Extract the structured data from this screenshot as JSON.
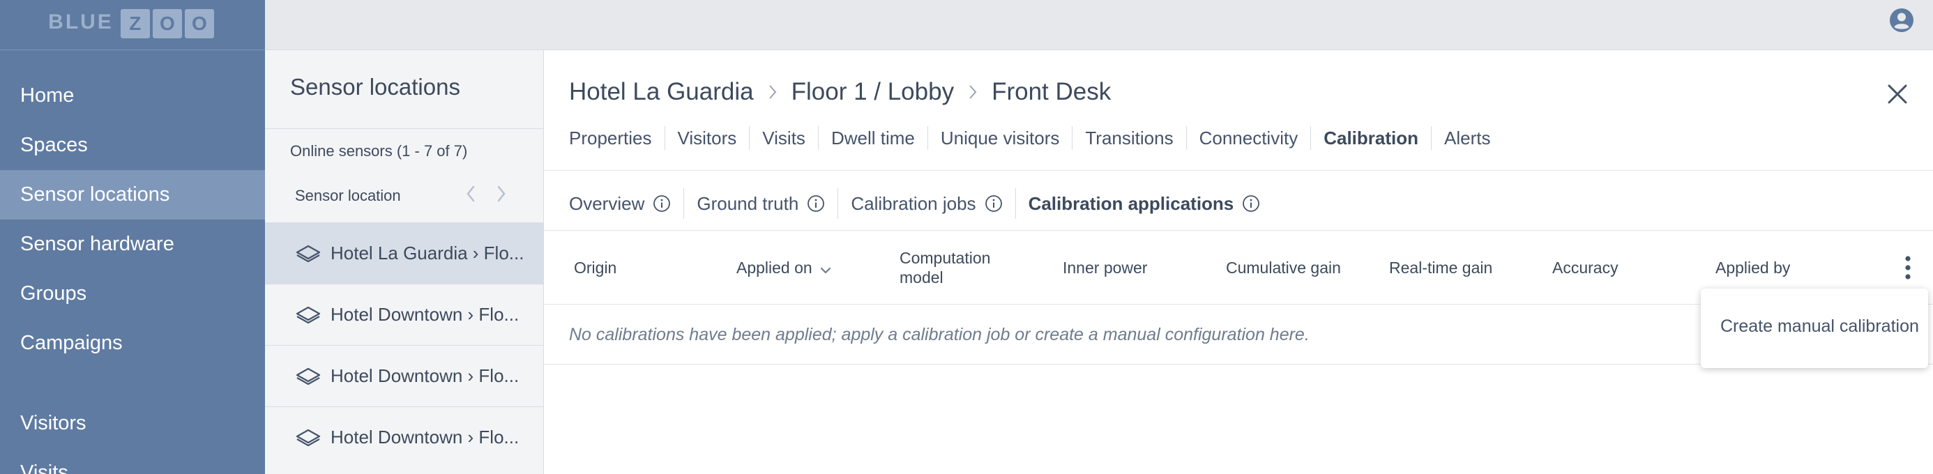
{
  "brand": {
    "word": "BLUE",
    "boxed_letters": [
      "Z",
      "O",
      "O"
    ]
  },
  "colors": {
    "nav_bg": "#5f7ba2",
    "nav_active": "#7f97b9",
    "topbar_bg": "#e6e8eb",
    "list_bg": "#f3f4f6",
    "list_selected": "#d7dee8",
    "text": "#3d4a5c",
    "muted_text": "#6f7c8d"
  },
  "nav": {
    "items": [
      {
        "label": "Home",
        "active": false
      },
      {
        "label": "Spaces",
        "active": false
      },
      {
        "label": "Sensor locations",
        "active": true
      },
      {
        "label": "Sensor hardware",
        "active": false
      },
      {
        "label": "Groups",
        "active": false
      },
      {
        "label": "Campaigns",
        "active": false
      }
    ],
    "items_lower": [
      {
        "label": "Visitors",
        "active": false
      },
      {
        "label": "Visits",
        "active": false
      }
    ]
  },
  "topbar": {
    "user_icon": "user-circle-icon"
  },
  "list_panel": {
    "title": "Sensor locations",
    "count_label": "Online sensors (1 - 7 of 7)",
    "column_label": "Sensor location",
    "rows": [
      {
        "label": "Hotel La Guardia › Flo...",
        "selected": true
      },
      {
        "label": "Hotel Downtown › Flo...",
        "selected": false
      },
      {
        "label": "Hotel Downtown › Flo...",
        "selected": false
      },
      {
        "label": "Hotel Downtown › Flo...",
        "selected": false
      }
    ]
  },
  "detail": {
    "breadcrumb": [
      "Hotel La Guardia",
      "Floor 1 / Lobby",
      "Front Desk"
    ],
    "tabs": [
      {
        "label": "Properties",
        "active": false
      },
      {
        "label": "Visitors",
        "active": false
      },
      {
        "label": "Visits",
        "active": false
      },
      {
        "label": "Dwell time",
        "active": false
      },
      {
        "label": "Unique visitors",
        "active": false
      },
      {
        "label": "Transitions",
        "active": false
      },
      {
        "label": "Connectivity",
        "active": false
      },
      {
        "label": "Calibration",
        "active": true
      },
      {
        "label": "Alerts",
        "active": false
      }
    ],
    "subtabs": [
      {
        "label": "Overview",
        "active": false
      },
      {
        "label": "Ground truth",
        "active": false
      },
      {
        "label": "Calibration jobs",
        "active": false
      },
      {
        "label": "Calibration applications",
        "active": true
      }
    ],
    "table": {
      "columns": [
        {
          "line1": "Origin",
          "line2": ""
        },
        {
          "line1": "Applied on",
          "line2": "",
          "sorted": "desc"
        },
        {
          "line1": "Computation",
          "line2": "model"
        },
        {
          "line1": "Inner power",
          "line2": ""
        },
        {
          "line1": "Cumulative gain",
          "line2": ""
        },
        {
          "line1": "Real-time gain",
          "line2": ""
        },
        {
          "line1": "Accuracy",
          "line2": ""
        },
        {
          "line1": "Applied by",
          "line2": ""
        }
      ],
      "empty_message": "No calibrations have been applied; apply a calibration job or create a manual configuration here."
    },
    "menu": {
      "item": "Create manual calibration"
    }
  }
}
